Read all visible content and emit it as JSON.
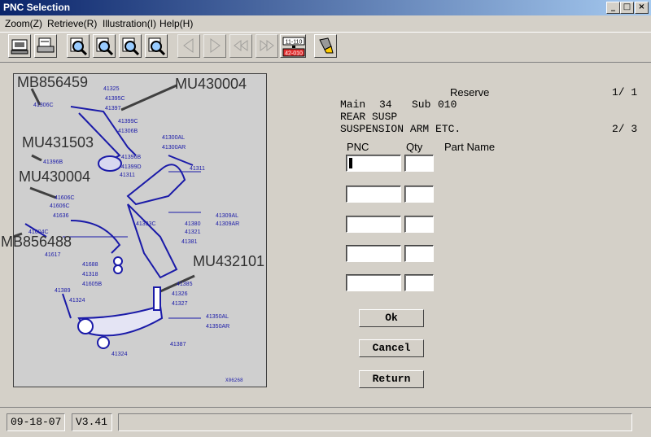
{
  "window": {
    "title": "PNC Selection",
    "min": "_",
    "max": "□",
    "close": "×"
  },
  "menu": [
    "Zoom(Z)",
    "Retrieve(R)",
    "Illustration(I)",
    "Help(H)"
  ],
  "toolbar": {
    "icons": [
      "print-icon",
      "print-setup-icon",
      "zoom-in-icon",
      "zoom-out-icon",
      "zoom-fit-icon",
      "zoom-reset-icon",
      "prev-arrow-icon",
      "next-arrow-icon",
      "first-page-icon",
      "last-page-icon",
      "serial-range-icon",
      "lamp-icon"
    ],
    "serial_top": "11-110",
    "serial_bottom": "42-010"
  },
  "illustration": {
    "callouts": [
      "MB856459",
      "MU430004",
      "MU431503",
      "MU430004",
      "MB856488",
      "MU432101"
    ],
    "part_labels": [
      "41325",
      "41306C",
      "41395C",
      "41397",
      "41399C",
      "41306B",
      "41300AL",
      "41300AR",
      "41396B",
      "41399D",
      "41396B",
      "41311",
      "41311",
      "41606C",
      "41606C",
      "41636",
      "41604C",
      "41617",
      "41393C",
      "41380",
      "41321",
      "41381",
      "41309AL",
      "41309AR",
      "41688",
      "41318",
      "41605B",
      "41389",
      "41324",
      "41385",
      "41326",
      "41327",
      "41350AL",
      "41350AR",
      "41387",
      "41324"
    ],
    "code": "X06268"
  },
  "details": {
    "reserve_label": "Reserve",
    "page_top": "1/ 1",
    "main_label": "Main",
    "main_value": "34",
    "sub_label": "Sub",
    "sub_value": "010",
    "line1": "REAR SUSP",
    "line2": "SUSPENSION ARM ETC.",
    "page_mid": "2/ 3"
  },
  "form": {
    "pnc_header": "PNC",
    "qty_header": "Qty",
    "partname_header": "Part Name",
    "rows": [
      {
        "pnc": "",
        "qty": ""
      },
      {
        "pnc": "",
        "qty": ""
      },
      {
        "pnc": "",
        "qty": ""
      },
      {
        "pnc": "",
        "qty": ""
      },
      {
        "pnc": "",
        "qty": ""
      }
    ]
  },
  "buttons": {
    "ok": "Ok",
    "cancel": "Cancel",
    "return": "Return"
  },
  "status": {
    "date": "09-18-07",
    "version": "V3.41",
    "message": ""
  }
}
